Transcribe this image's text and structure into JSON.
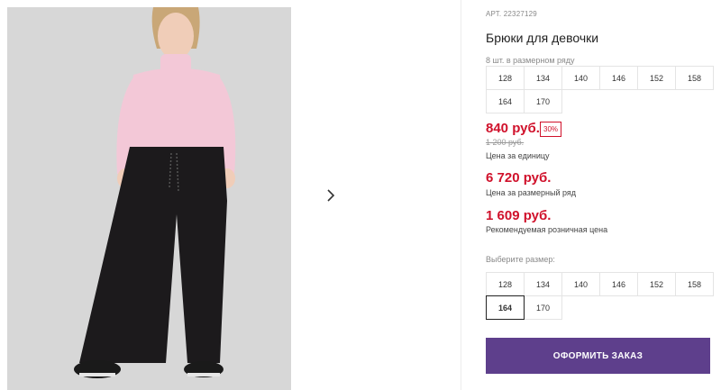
{
  "gallery": {
    "next_icon": "chevron-right-icon",
    "colors": {
      "background": "#d7d7d7",
      "sweater": "#f3c8d7",
      "pants": "#1c1a1c"
    }
  },
  "product": {
    "article_label": "АРТ. 22327129",
    "title": "Брюки для девочки",
    "size_note": "8 шт. в размерном ряду",
    "size_range": [
      "128",
      "134",
      "140",
      "146",
      "152",
      "158",
      "164",
      "170"
    ]
  },
  "pricing": {
    "price": "840 руб.",
    "discount_badge": "30%",
    "old_price": "1 200 руб.",
    "unit_label": "Цена за единицу",
    "set_price": "6 720 руб.",
    "set_label": "Цена за размерный ряд",
    "rrp_price": "1 609 руб.",
    "rrp_label": "Рекомендуемая розничная цена",
    "accent_color": "#d0112b"
  },
  "size_picker": {
    "label": "Выберите размер:",
    "options": [
      "128",
      "134",
      "140",
      "146",
      "152",
      "158",
      "164",
      "170"
    ],
    "selected": "164"
  },
  "order": {
    "button_label": "ОФОРМИТЬ ЗАКАЗ",
    "button_color": "#5e3f8c"
  }
}
